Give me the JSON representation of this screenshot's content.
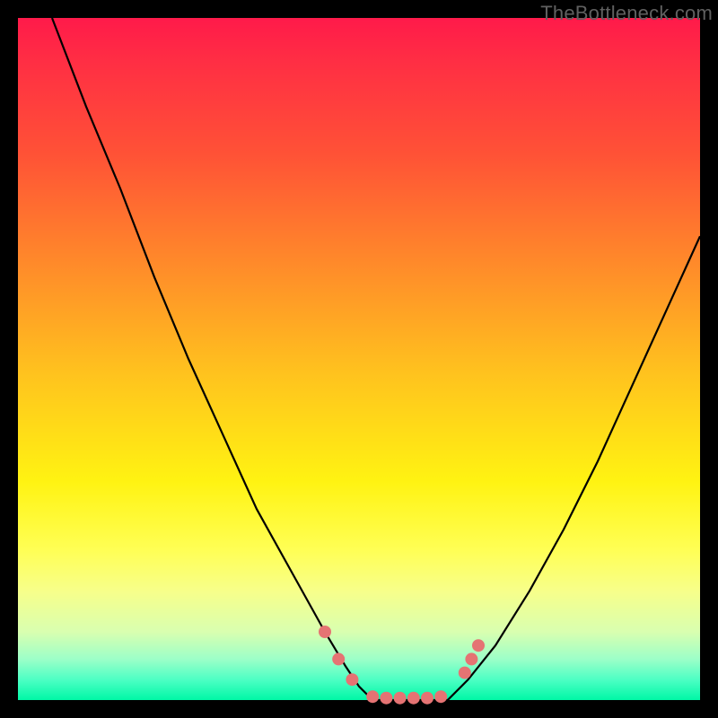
{
  "watermark": "TheBottleneck.com",
  "colors": {
    "frame": "#000000",
    "curve": "#000000",
    "marker": "#e57373",
    "gradient_stops": [
      "#ff1a4a",
      "#ff5236",
      "#ff8a2a",
      "#ffc21e",
      "#fff312",
      "#ffff55",
      "#d9ffb0",
      "#4dffc4",
      "#00f7a6"
    ]
  },
  "chart_data": {
    "type": "line",
    "title": "",
    "xlabel": "",
    "ylabel": "",
    "x_range": [
      0,
      100
    ],
    "y_range": [
      0,
      100
    ],
    "grid": false,
    "legend": false,
    "note": "V-shaped bottleneck curve over rainbow heat gradient. y≈100 is at the top (red), y≈0 at the bottom (green). Curve reaches ~0 between x≈52 and x≈63.",
    "series": [
      {
        "name": "curve-left",
        "x": [
          5,
          10,
          15,
          20,
          25,
          30,
          35,
          40,
          45,
          48,
          50,
          52
        ],
        "y": [
          100,
          87,
          75,
          62,
          50,
          39,
          28,
          19,
          10,
          5,
          2,
          0
        ]
      },
      {
        "name": "flat-min",
        "x": [
          52,
          55,
          58,
          61,
          63
        ],
        "y": [
          0,
          0,
          0,
          0,
          0
        ]
      },
      {
        "name": "curve-right",
        "x": [
          63,
          66,
          70,
          75,
          80,
          85,
          90,
          95,
          100
        ],
        "y": [
          0,
          3,
          8,
          16,
          25,
          35,
          46,
          57,
          68
        ]
      }
    ],
    "markers": {
      "name": "highlight-dots",
      "note": "salmon rounded markers near the valley",
      "points": [
        {
          "x": 45,
          "y": 10
        },
        {
          "x": 47,
          "y": 6
        },
        {
          "x": 49,
          "y": 3
        },
        {
          "x": 52,
          "y": 0.5
        },
        {
          "x": 54,
          "y": 0.3
        },
        {
          "x": 56,
          "y": 0.3
        },
        {
          "x": 58,
          "y": 0.3
        },
        {
          "x": 60,
          "y": 0.3
        },
        {
          "x": 62,
          "y": 0.5
        },
        {
          "x": 65.5,
          "y": 4
        },
        {
          "x": 66.5,
          "y": 6
        },
        {
          "x": 67.5,
          "y": 8
        }
      ]
    }
  }
}
